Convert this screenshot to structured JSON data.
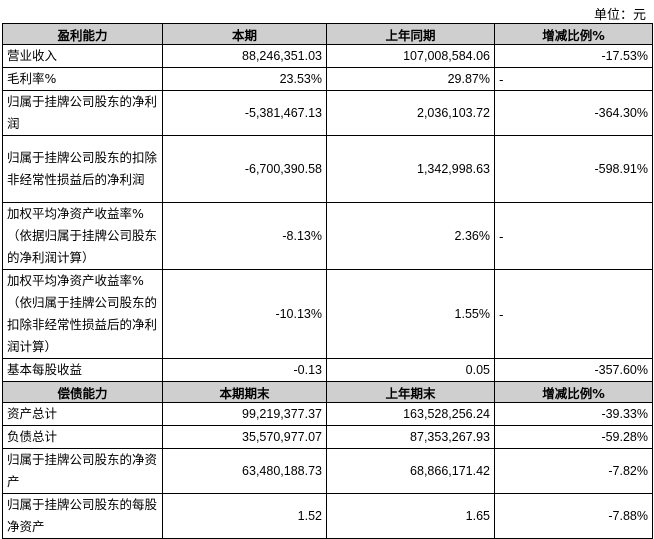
{
  "unit_label": "单位：元",
  "section_profit": {
    "header": [
      "盈利能力",
      "本期",
      "上年同期",
      "增减比例%"
    ],
    "rows": [
      {
        "label": "营业收入",
        "current": "88,246,351.03",
        "prior": "107,008,584.06",
        "change": "-17.53%"
      },
      {
        "label": "毛利率%",
        "current": "23.53%",
        "prior": "29.87%",
        "change": "-"
      },
      {
        "label": "归属于挂牌公司股东的净利润",
        "current": "-5,381,467.13",
        "prior": "2,036,103.72",
        "change": "-364.30%"
      },
      {
        "label": "归属于挂牌公司股东的扣除非经常性损益后的净利润",
        "current": "-6,700,390.58",
        "prior": "1,342,998.63",
        "change": "-598.91%"
      },
      {
        "label": "加权平均净资产收益率%（依据归属于挂牌公司股东的净利润计算）",
        "current": "-8.13%",
        "prior": "2.36%",
        "change": "-"
      },
      {
        "label": "加权平均净资产收益率%（依归属于挂牌公司股东的扣除非经常性损益后的净利润计算）",
        "current": "-10.13%",
        "prior": "1.55%",
        "change": "-"
      },
      {
        "label": "基本每股收益",
        "current": "-0.13",
        "prior": "0.05",
        "change": "-357.60%"
      }
    ]
  },
  "section_solvency": {
    "header": [
      "偿债能力",
      "本期期末",
      "上年期末",
      "增减比例%"
    ],
    "rows": [
      {
        "label": "资产总计",
        "current": "99,219,377.37",
        "prior": "163,528,256.24",
        "change": "-39.33%"
      },
      {
        "label": "负债总计",
        "current": "35,570,977.07",
        "prior": "87,353,267.93",
        "change": "-59.28%"
      },
      {
        "label": "归属于挂牌公司股东的净资产",
        "current": "63,480,188.73",
        "prior": "68,866,171.42",
        "change": "-7.82%"
      },
      {
        "label": "归属于挂牌公司股东的每股净资产",
        "current": "1.52",
        "prior": "1.65",
        "change": "-7.88%"
      }
    ]
  },
  "colors": {
    "header_bg": "#cfcfcf",
    "border": "#000000"
  }
}
